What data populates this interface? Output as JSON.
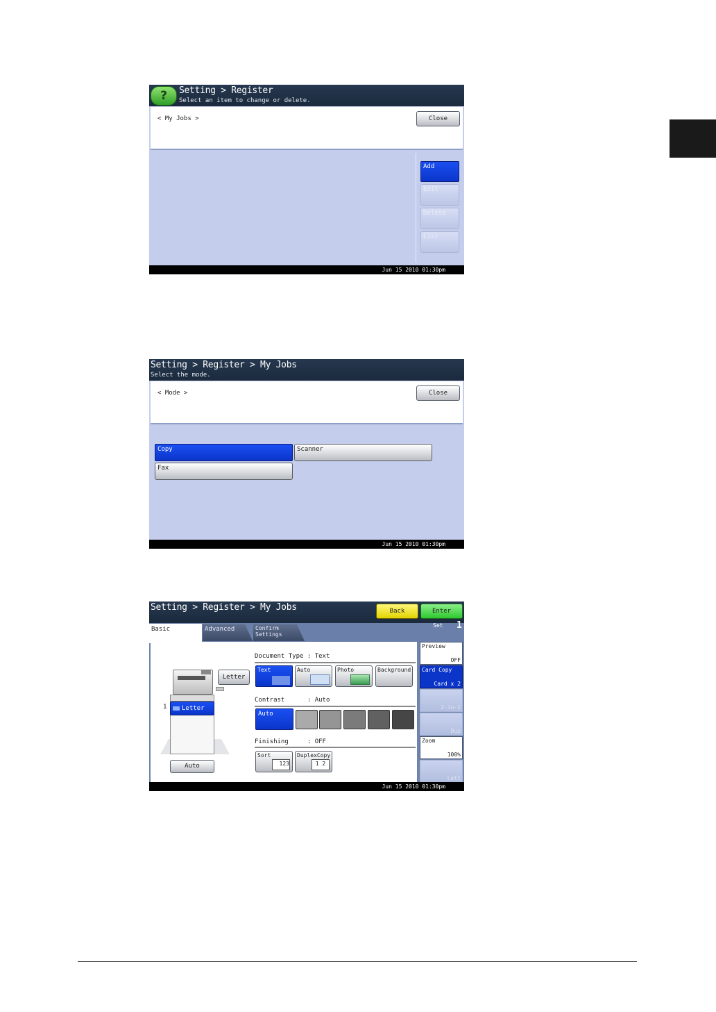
{
  "screen1": {
    "title": "Setting > Register",
    "subtitle": "Select an item to change or delete.",
    "help_label": "?",
    "panel_label": "< My Jobs >",
    "close": "Close",
    "side_buttons": [
      "Add",
      "Edit",
      "Delete",
      "List"
    ],
    "status_time": "Jun 15 2010 01:30pm"
  },
  "screen2": {
    "title": "Setting > Register > My Jobs",
    "subtitle": "Select the mode.",
    "panel_label": "< Mode >",
    "close": "Close",
    "modes": [
      "Copy",
      "Scanner",
      "Fax"
    ],
    "status_time": "Jun 15 2010 01:30pm"
  },
  "screen3": {
    "title": "Setting > Register > My Jobs",
    "back": "Back",
    "enter": "Enter",
    "set_label": "Set",
    "set_value": "1",
    "tabs": [
      "Basic",
      "Advanced",
      "Confirm Settings"
    ],
    "paper_button": "Letter",
    "tray_number": "1",
    "tray_label": "Letter",
    "auto_button": "Auto",
    "doc_type_title": "Document Type : Text",
    "doc_types": [
      "Text",
      "Auto",
      "Photo",
      "Background"
    ],
    "contrast_title": "Contrast      : Auto",
    "contrast_auto": "Auto",
    "contrast_swatches": [
      "#aaaaaa",
      "#959595",
      "#7b7b7b",
      "#616161",
      "#464646"
    ],
    "finishing_title": "Finishing     : OFF",
    "finishing": [
      "Sort",
      "DuplexCopy"
    ],
    "right_panel": {
      "preview_label": "Preview",
      "preview_value": "OFF",
      "card_copy_label": "Card Copy",
      "card_copy_value": "Card x 2",
      "dim1": "2-in-1",
      "dim2": "Dup",
      "zoom_label": "Zoom",
      "zoom_value": "100%",
      "dim3": "Lett"
    },
    "status_time": "Jun 15 2010 01:30pm"
  },
  "colors": {
    "screen_bg": "#c4cdec",
    "header_bg": "#1b2a3d",
    "selected_blue": "#0b35c9",
    "enter_green": "#2fc72f",
    "back_yellow": "#e3d400"
  }
}
